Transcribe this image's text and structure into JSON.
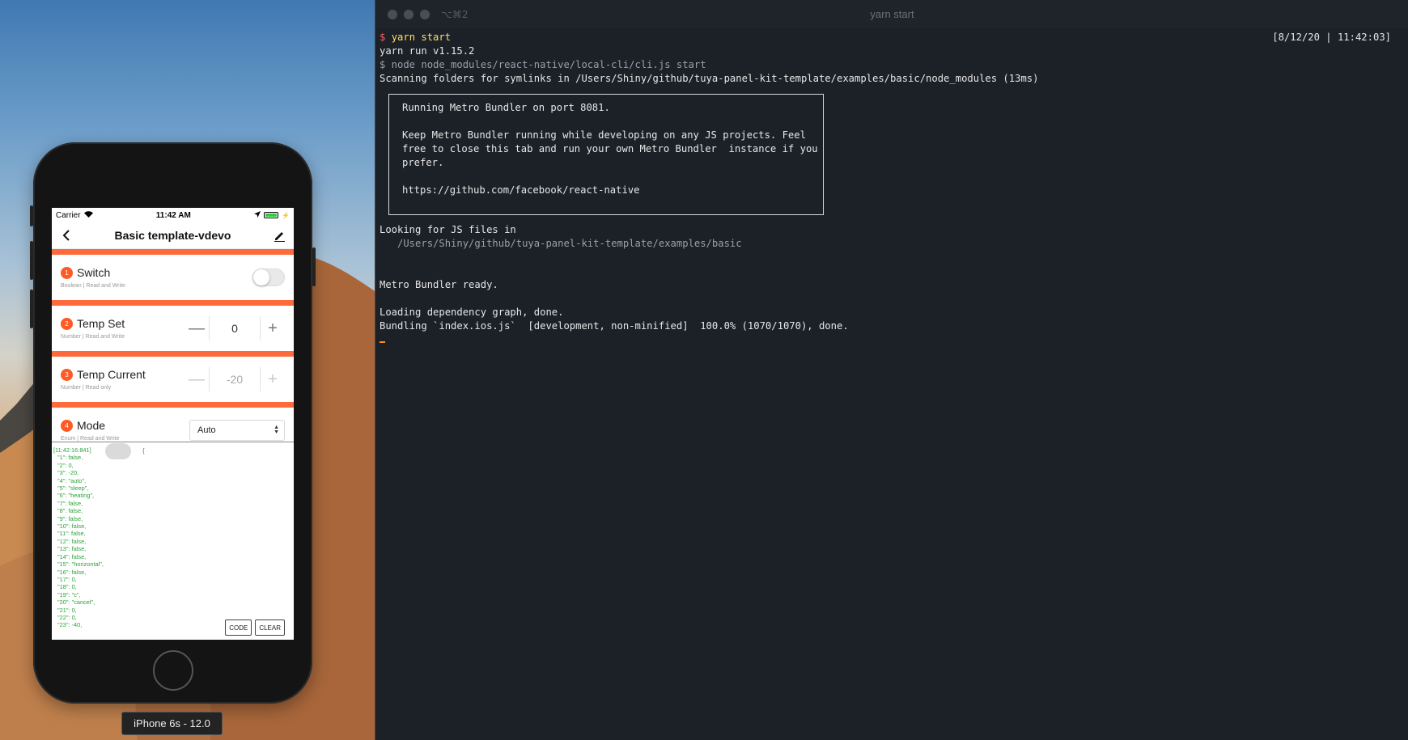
{
  "simulator": {
    "device_label": "iPhone 6s - 12.0",
    "statusbar": {
      "carrier": "Carrier",
      "time": "11:42 AM"
    },
    "navbar": {
      "title": "Basic template-vdevo"
    },
    "datapoints": [
      {
        "index": "1",
        "name": "Switch",
        "sub": "Boolean | Read and Write",
        "control": "toggle",
        "on": false
      },
      {
        "index": "2",
        "name": "Temp Set",
        "sub": "Number | Read and Write",
        "control": "stepper",
        "value": "0"
      },
      {
        "index": "3",
        "name": "Temp Current",
        "sub": "Number | Read only",
        "control": "stepper-disabled",
        "value": "-20"
      },
      {
        "index": "4",
        "name": "Mode",
        "sub": "Enum | Read and Write",
        "control": "select",
        "value": "Auto"
      }
    ],
    "stepper": {
      "minus": "—",
      "plus": "+"
    },
    "log": {
      "timestamp": "[11:42:16:841]",
      "open_brace": "{",
      "lines": [
        "\"1\": false,",
        "\"2\": 0,",
        "\"3\": -20,",
        "\"4\": \"auto\",",
        "\"5\": \"sleep\",",
        "\"6\": \"heating\",",
        "\"7\": false,",
        "\"8\": false,",
        "\"9\": false,",
        "\"10\": false,",
        "\"11\": false,",
        "\"12\": false,",
        "\"13\": false,",
        "\"14\": false,",
        "\"15\": \"horizontal\",",
        "\"16\": false,",
        "\"17\": 0,",
        "\"18\": 0,",
        "\"19\": \"c\",",
        "\"20\": \"cancel\",",
        "\"21\": 0,",
        "\"22\": 0,",
        "\"23\": -40,"
      ],
      "code_button": "CODE",
      "clear_button": "CLEAR"
    }
  },
  "terminal": {
    "shortcut": "⌥⌘2",
    "title": "yarn start",
    "timestamp": "[8/12/20 | 11:42:03]",
    "prompt_symbol": "$",
    "command": "yarn start",
    "line_yarn_version": "yarn run v1.15.2",
    "line_node": "$ node node_modules/react-native/local-cli/cli.js start",
    "line_scanning": "Scanning folders for symlinks in /Users/Shiny/github/tuya-panel-kit-template/examples/basic/node_modules (13ms)",
    "box": {
      "line1": "Running Metro Bundler on port 8081.",
      "line2": "Keep Metro Bundler running while developing on any JS projects. Feel",
      "line3": "free to close this tab and run your own Metro Bundler  instance if you",
      "line4": "prefer.",
      "line5": "https://github.com/facebook/react-native"
    },
    "line_looking": "Looking for JS files in",
    "line_path": "   /Users/Shiny/github/tuya-panel-kit-template/examples/basic",
    "line_ready": "Metro Bundler ready.",
    "line_loading": "Loading dependency graph, done.",
    "line_bundling": "Bundling `index.ios.js`  [development, non-minified]  100.0% (1070/1070), done."
  }
}
